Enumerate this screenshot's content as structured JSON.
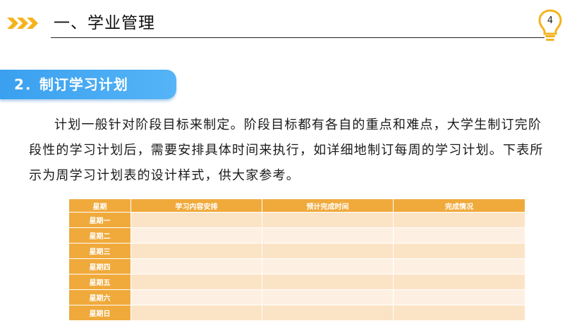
{
  "header": {
    "title": "一、学业管理",
    "page_number": "4",
    "accent_color": "#f4b31d"
  },
  "section": {
    "title": "2．制订学习计划",
    "color": "#3aa0ef"
  },
  "paragraph": "计划一般针对阶段目标来制定。阶段目标都有各自的重点和难点，大学生制订完阶段性的学习计划后，需要安排具体时间来执行，如详细地制订每周的学习计划。下表所示为周学习计划表的设计样式，供大家参考。",
  "table": {
    "headers": [
      "星期",
      "学习内容安排",
      "预计完成时间",
      "完成情况"
    ],
    "rows": [
      "星期一",
      "星期二",
      "星期三",
      "星期四",
      "星期五",
      "星期六",
      "星期日"
    ],
    "header_color": "#f0aa3c"
  }
}
